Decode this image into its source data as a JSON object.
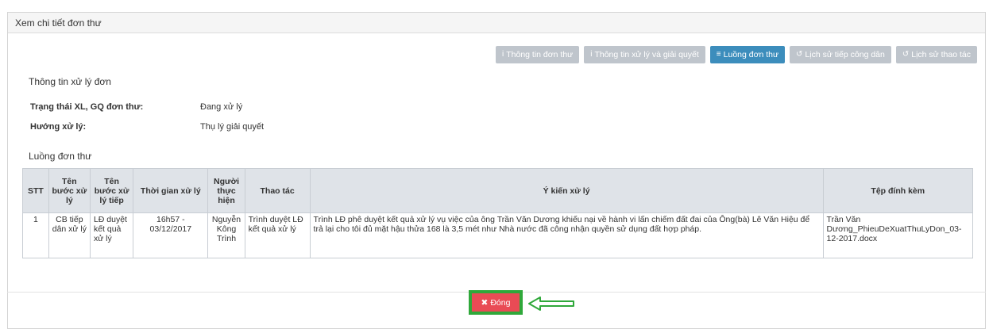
{
  "panel": {
    "title": "Xem chi tiết đơn thư"
  },
  "toolbar": [
    {
      "label": "Thông tin đơn thư",
      "icon": "i",
      "active": false
    },
    {
      "label": "Thông tin xử lý và giải quyết",
      "icon": "i",
      "active": false
    },
    {
      "label": "Luồng đơn thư",
      "icon": "≡",
      "active": true
    },
    {
      "label": "Lịch sử tiếp công dân",
      "icon": "↺",
      "active": false
    },
    {
      "label": "Lịch sử thao tác",
      "icon": "↺",
      "active": false
    }
  ],
  "processing": {
    "title": "Thông tin xử lý đơn",
    "status_label": "Trạng thái XL, GQ đơn thư:",
    "status_value": "Đang xử lý",
    "direction_label": "Hướng xử lý:",
    "direction_value": "Thụ lý giải quyết"
  },
  "flow": {
    "title": "Luồng đơn thư",
    "columns": [
      "STT",
      "Tên bước xử lý",
      "Tên bước xử lý tiếp",
      "Thời gian xử lý",
      "Người thực hiện",
      "Thao tác",
      "Ý kiến xử lý",
      "Tệp đính kèm"
    ],
    "rows": [
      {
        "stt": "1",
        "step": "CB tiếp dân xử lý",
        "next_step": "LĐ duyệt kết quả xử lý",
        "time": "16h57 - 03/12/2017",
        "person": "Nguyễn Kông Trình",
        "action": "Trình duyệt LĐ kết quả xử lý",
        "opinion": "Trình LĐ phê duyệt kết quả xử lý vụ việc của ông Trần Văn Dương khiếu nại về hành vi lấn chiếm đất đai của Ông(bà) Lê Văn Hiệu để trả lại cho tôi đủ mặt hậu thửa 168 là 3,5 mét như Nhà nước đã công nhận quyền sử dụng đất hợp pháp.",
        "attachment": "Trần Văn Dương_PhieuDeXuatThuLyDon_03-12-2017.docx"
      }
    ]
  },
  "footer": {
    "close_label": "Đóng"
  },
  "colors": {
    "active_tab": "#3c8dbc",
    "inactive_tab": "#bfc5cc",
    "close": "#e94b55",
    "highlight": "#2fa83a"
  }
}
